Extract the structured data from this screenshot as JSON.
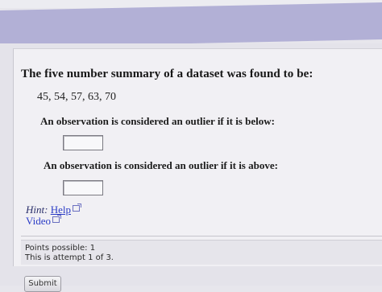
{
  "question": {
    "title": "The five number summary of a dataset was found to be:",
    "values": "45, 54, 57, 63, 70",
    "prompt_below": "An observation is considered an outlier if it is below:",
    "prompt_above": "An observation is considered an outlier if it is above:",
    "answer_below": "",
    "answer_above": ""
  },
  "hint": {
    "label": "Hint:",
    "help_link": "Help",
    "video_link": "Video"
  },
  "info": {
    "points": "Points possible: 1",
    "attempt": "This is attempt 1 of 3."
  },
  "submit_label": "Submit",
  "colors": {
    "banner": "#b2b0d6",
    "link": "#2b3cc6"
  }
}
